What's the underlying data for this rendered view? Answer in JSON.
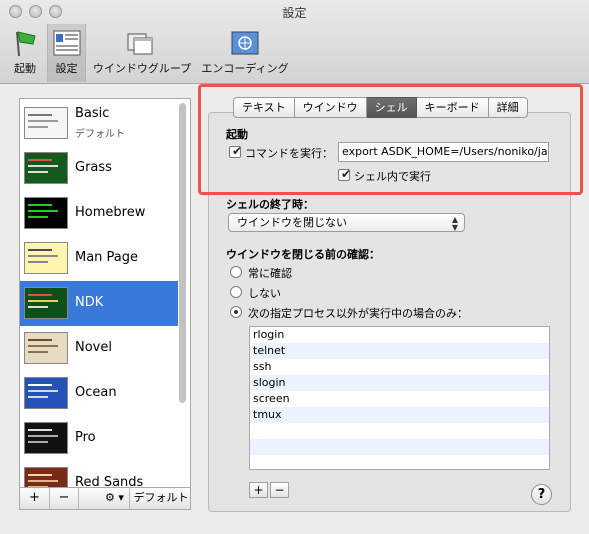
{
  "window": {
    "title": "設定"
  },
  "toolbar": {
    "items": [
      {
        "label": "起動"
      },
      {
        "label": "設定"
      },
      {
        "label": "ウインドウグループ"
      },
      {
        "label": "エンコーディング"
      }
    ]
  },
  "profiles": {
    "items": [
      {
        "name": "Basic",
        "sub": "デフォルト"
      },
      {
        "name": "Grass"
      },
      {
        "name": "Homebrew"
      },
      {
        "name": "Man Page"
      },
      {
        "name": "NDK"
      },
      {
        "name": "Novel"
      },
      {
        "name": "Ocean"
      },
      {
        "name": "Pro"
      },
      {
        "name": "Red Sands"
      }
    ],
    "selected": "NDK",
    "buttons": {
      "add": "+",
      "remove": "−",
      "gear": "⚙ ▾",
      "default": "デフォルト"
    }
  },
  "tabs": {
    "items": [
      "テキスト",
      "ウインドウ",
      "シェル",
      "キーボード",
      "詳細"
    ],
    "active": "シェル"
  },
  "startup": {
    "heading": "起動",
    "run_command_label": "コマンドを実行：",
    "command_value": "export ASDK_HOME=/Users/noniko/ja",
    "run_in_shell_label": "シェル内で実行"
  },
  "shell_exit": {
    "heading": "シェルの終了時：",
    "selected": "ウインドウを閉じない"
  },
  "close_confirm": {
    "heading": "ウインドウを閉じる前の確認：",
    "options": [
      "常に確認",
      "しない",
      "次の指定プロセス以外が実行中の場合のみ："
    ],
    "processes": [
      "rlogin",
      "telnet",
      "ssh",
      "slogin",
      "screen",
      "tmux"
    ],
    "add": "+",
    "remove": "−"
  },
  "help": {
    "label": "?"
  },
  "colors": {
    "accent": "#3879d9",
    "highlight": "#e8554a"
  }
}
